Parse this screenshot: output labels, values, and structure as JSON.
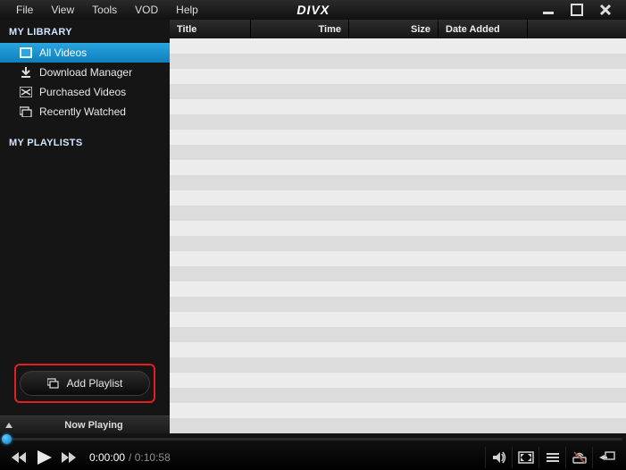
{
  "menu": {
    "items": [
      "File",
      "View",
      "Tools",
      "VOD",
      "Help"
    ]
  },
  "logo": "DIVX",
  "sidebar": {
    "library_header": "MY LIBRARY",
    "playlists_header": "MY PLAYLISTS",
    "items": [
      {
        "label": "All Videos"
      },
      {
        "label": "Download Manager"
      },
      {
        "label": "Purchased Videos"
      },
      {
        "label": "Recently Watched"
      }
    ],
    "add_playlist_label": "Add Playlist"
  },
  "now_playing": {
    "label": "Now Playing"
  },
  "columns": {
    "title": "Title",
    "time": "Time",
    "size": "Size",
    "date": "Date Added"
  },
  "player": {
    "elapsed": "0:00:00",
    "duration": "0:10:58",
    "separator": " / "
  }
}
